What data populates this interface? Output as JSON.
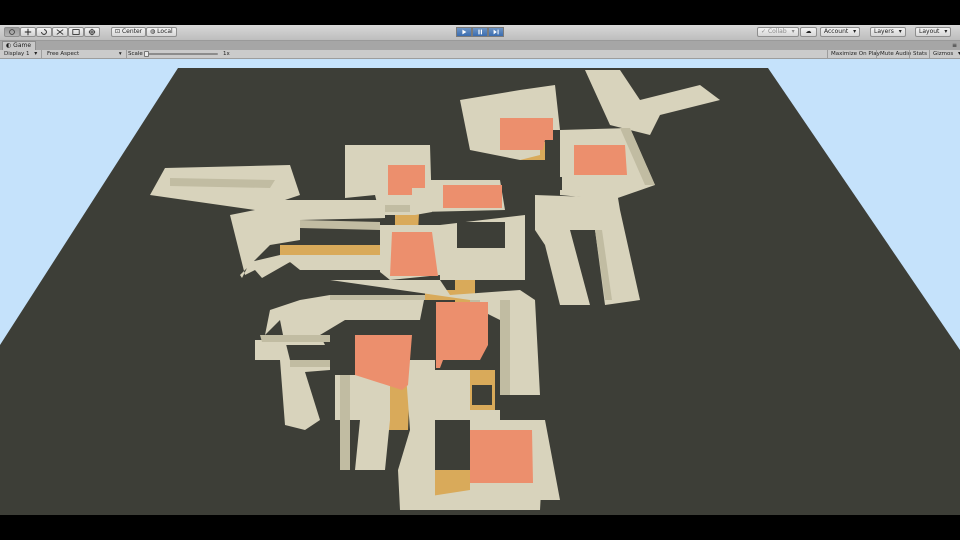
{
  "toolbar": {
    "tools": [
      "hand",
      "move",
      "rotate",
      "scale",
      "rect",
      "transform"
    ],
    "pivot_label": "Center",
    "space_label": "Local",
    "play_controls": [
      "play",
      "pause",
      "step"
    ],
    "collab_label": "Collab",
    "account_label": "Account",
    "layers_label": "Layers",
    "layout_label": "Layout"
  },
  "tab": {
    "title": "Game"
  },
  "gamebar": {
    "display_label": "Display 1",
    "aspect_label": "Free Aspect",
    "scale_label": "Scale",
    "scale_value": "1x",
    "maximize_label": "Maximize On Play",
    "mute_label": "Mute Audio",
    "stats_label": "Stats",
    "gizmos_label": "Gizmos"
  },
  "scene": {
    "sky_color": "#c5e2fb",
    "ground_color": "#3d3e37",
    "floor_color": "#d8d3bc",
    "wall_top_color": "#d2cdb3",
    "wall_side_color": "#c1bca2",
    "room_color": "#ec8f6d",
    "corridor_color": "#d9aa5a"
  },
  "colors": {
    "accent_play": "#3a6db0"
  }
}
